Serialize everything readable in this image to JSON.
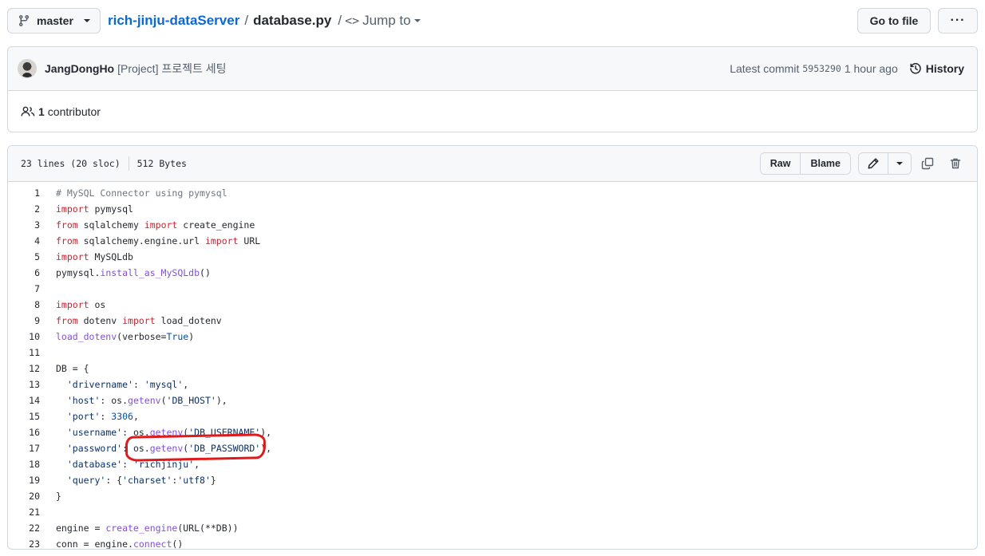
{
  "topbar": {
    "branch": "master",
    "repo": "rich-jinju-dataServer",
    "separator": "/",
    "file": "database.py",
    "jump_separator": "/",
    "jump_label": "Jump to",
    "go_to_file": "Go to file",
    "more": "···"
  },
  "commit": {
    "author": "JangDongHo",
    "message": "[Project] 프로젝트 세팅",
    "latest_label": "Latest commit",
    "sha": "5953290",
    "time": "1 hour ago",
    "history": "History"
  },
  "contributors": {
    "count": "1",
    "label": "contributor"
  },
  "file_header": {
    "lines": "23 lines (20 sloc)",
    "size": "512 Bytes",
    "raw": "Raw",
    "blame": "Blame"
  },
  "code": [
    [
      [
        "comment",
        "# MySQL Connector using pymysql"
      ]
    ],
    [
      [
        "keyword",
        "import"
      ],
      [
        "plain",
        " pymysql"
      ]
    ],
    [
      [
        "keyword",
        "from"
      ],
      [
        "plain",
        " sqlalchemy "
      ],
      [
        "keyword",
        "import"
      ],
      [
        "plain",
        " create_engine"
      ]
    ],
    [
      [
        "keyword",
        "from"
      ],
      [
        "plain",
        " sqlalchemy.engine.url "
      ],
      [
        "keyword",
        "import"
      ],
      [
        "plain",
        " URL"
      ]
    ],
    [
      [
        "keyword",
        "import"
      ],
      [
        "plain",
        " MySQLdb"
      ]
    ],
    [
      [
        "plain",
        "pymysql."
      ],
      [
        "func",
        "install_as_MySQLdb"
      ],
      [
        "plain",
        "()"
      ]
    ],
    [],
    [
      [
        "keyword",
        "import"
      ],
      [
        "plain",
        " os"
      ]
    ],
    [
      [
        "keyword",
        "from"
      ],
      [
        "plain",
        " dotenv "
      ],
      [
        "keyword",
        "import"
      ],
      [
        "plain",
        " load_dotenv"
      ]
    ],
    [
      [
        "func",
        "load_dotenv"
      ],
      [
        "plain",
        "(verbose="
      ],
      [
        "const",
        "True"
      ],
      [
        "plain",
        ")"
      ]
    ],
    [],
    [
      [
        "plain",
        "DB = {"
      ]
    ],
    [
      [
        "plain",
        "  "
      ],
      [
        "string",
        "'drivername'"
      ],
      [
        "plain",
        ": "
      ],
      [
        "string",
        "'mysql'"
      ],
      [
        "plain",
        ","
      ]
    ],
    [
      [
        "plain",
        "  "
      ],
      [
        "string",
        "'host'"
      ],
      [
        "plain",
        ": os."
      ],
      [
        "func",
        "getenv"
      ],
      [
        "plain",
        "("
      ],
      [
        "string",
        "'DB_HOST'"
      ],
      [
        "plain",
        "),"
      ]
    ],
    [
      [
        "plain",
        "  "
      ],
      [
        "string",
        "'port'"
      ],
      [
        "plain",
        ": "
      ],
      [
        "const",
        "3306"
      ],
      [
        "plain",
        ","
      ]
    ],
    [
      [
        "plain",
        "  "
      ],
      [
        "string",
        "'username'"
      ],
      [
        "plain",
        ": os."
      ],
      [
        "func",
        "getenv"
      ],
      [
        "plain",
        "("
      ],
      [
        "string",
        "'DB_USERNAME'"
      ],
      [
        "plain",
        "),"
      ]
    ],
    [
      [
        "plain",
        "  "
      ],
      [
        "string",
        "'password'"
      ],
      [
        "plain",
        ": os."
      ],
      [
        "func",
        "getenv"
      ],
      [
        "plain",
        "("
      ],
      [
        "string",
        "'DB_PASSWORD'"
      ],
      [
        "plain",
        "),"
      ]
    ],
    [
      [
        "plain",
        "  "
      ],
      [
        "string",
        "'database'"
      ],
      [
        "plain",
        ": "
      ],
      [
        "string",
        "'richjinju'"
      ],
      [
        "plain",
        ","
      ]
    ],
    [
      [
        "plain",
        "  "
      ],
      [
        "string",
        "'query'"
      ],
      [
        "plain",
        ": {"
      ],
      [
        "string",
        "'charset'"
      ],
      [
        "plain",
        ":"
      ],
      [
        "string",
        "'utf8'"
      ],
      [
        "plain",
        "}"
      ]
    ],
    [
      [
        "plain",
        "}"
      ]
    ],
    [],
    [
      [
        "plain",
        "engine = "
      ],
      [
        "func",
        "create_engine"
      ],
      [
        "plain",
        "(URL(**DB))"
      ]
    ],
    [
      [
        "plain",
        "conn = engine."
      ],
      [
        "func",
        "connect"
      ],
      [
        "plain",
        "()"
      ]
    ]
  ],
  "colors": {
    "link": "#0969da",
    "keyword": "#cf222e",
    "function": "#8250df",
    "annotation": "#e0191b"
  }
}
